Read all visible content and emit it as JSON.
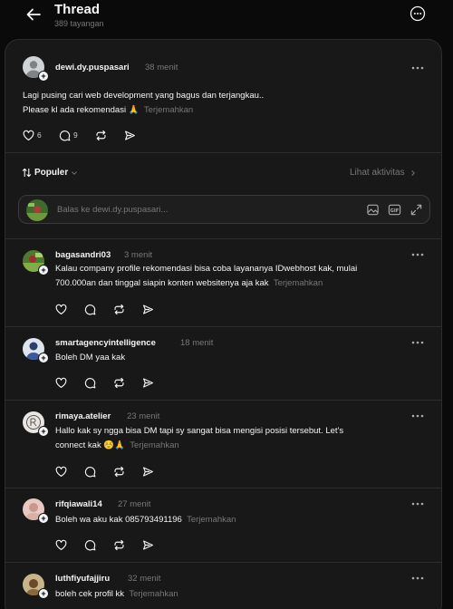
{
  "header": {
    "title": "Thread",
    "views": "389 tayangan"
  },
  "post": {
    "username": "dewi.dy.puspasari",
    "time": "38 menit",
    "line1": "Lagi pusing cari web development yang bagus dan terjangkau..",
    "line2": "Please kl ada rekomendasi 🙏",
    "translate": "Terjemahkan",
    "likes": "6",
    "comments": "9"
  },
  "controls": {
    "sort_label": "Populer",
    "activity_label": "Lihat aktivitas",
    "reply_placeholder": "Balas ke dewi.dy.puspasari..."
  },
  "replies": [
    {
      "username": "bagasandri03",
      "time": "3 menit",
      "line1": "Kalau company profile rekomendasi bisa coba layananya IDwebhost kak, mulai",
      "line2": "700.000an dan tinggal siapin konten websitenya aja kak",
      "translate": "Terjemahkan"
    },
    {
      "username": "smartagencyintelligence",
      "time": "18 menit",
      "line1": "Boleh DM yaa kak",
      "line2": "",
      "translate": ""
    },
    {
      "username": "rimaya.atelier",
      "time": "23 menit",
      "line1": "Hallo kak sy ngga bisa DM tapi sy sangat bisa mengisi posisi tersebut. Let's",
      "line2": "connect kak ☺️🙏",
      "translate": "Terjemahkan"
    },
    {
      "username": "rifqiawali14",
      "time": "27 menit",
      "line1": "Boleh wa aku kak 085793491196",
      "line2": "",
      "translate": "Terjemahkan"
    },
    {
      "username": "luthfiyufajjiru",
      "time": "32 menit",
      "line1": "boleh cek profil kk",
      "line2": "",
      "translate": "Terjemahkan"
    }
  ],
  "colors": {
    "background": "#0a0a0a",
    "panel": "#181818",
    "border": "#2d2d2d",
    "text": "#f3f5f7",
    "muted": "#777777"
  }
}
